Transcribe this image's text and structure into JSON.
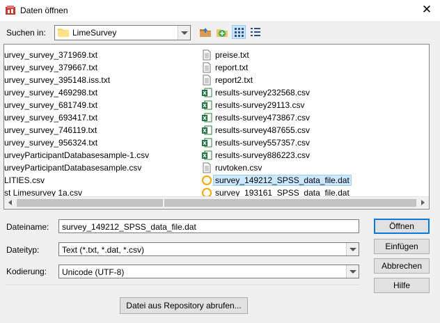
{
  "window": {
    "title": "Daten öffnen",
    "close_glyph": "✕"
  },
  "toolbar": {
    "lookin_label": "Suchen in:",
    "folder": "LimeSurvey",
    "icons": [
      "up-folder-icon",
      "new-folder-icon",
      "list-view-icon",
      "details-view-icon"
    ]
  },
  "files": {
    "left_column": [
      "urvey_survey_371969.txt",
      "urvey_survey_379667.txt",
      "urvey_survey_395148.iss.txt",
      "urvey_survey_469298.txt",
      "urvey_survey_681749.txt",
      "urvey_survey_693417.txt",
      "urvey_survey_746119.txt",
      "urvey_survey_956324.txt",
      "urveyParticipantDatabasesample-1.csv",
      "urveyParticipantDatabasesample.csv",
      "LITIES.csv",
      "st Limesurvey 1a.csv"
    ],
    "right_column": [
      {
        "name": "preise.txt",
        "icon": "text-file-icon"
      },
      {
        "name": "report.txt",
        "icon": "text-file-icon"
      },
      {
        "name": "report2.txt",
        "icon": "text-file-icon"
      },
      {
        "name": "results-survey232568.csv",
        "icon": "excel-file-icon"
      },
      {
        "name": "results-survey29113.csv",
        "icon": "excel-file-icon"
      },
      {
        "name": "results-survey473867.csv",
        "icon": "excel-file-icon"
      },
      {
        "name": "results-survey487655.csv",
        "icon": "excel-file-icon"
      },
      {
        "name": "results-survey557357.csv",
        "icon": "excel-file-icon"
      },
      {
        "name": "results-survey886223.csv",
        "icon": "excel-file-icon"
      },
      {
        "name": "ruvtoken.csv",
        "icon": "text-file-icon"
      },
      {
        "name": "survey_149212_SPSS_data_file.dat",
        "icon": "spss-data-icon",
        "selected": true
      },
      {
        "name": "survey_193161_SPSS_data_file.dat",
        "icon": "spss-data-icon"
      }
    ]
  },
  "form": {
    "filename_label": "Dateiname:",
    "filename_value": "survey_149212_SPSS_data_file.dat",
    "filetype_label": "Dateityp:",
    "filetype_value": "Text (*.txt, *.dat, *.csv)",
    "encoding_label": "Kodierung:",
    "encoding_value": "Unicode (UTF-8)"
  },
  "buttons": {
    "open": "Öffnen",
    "paste": "Einfügen",
    "cancel": "Abbrechen",
    "help": "Hilfe",
    "repository": "Datei aus Repository abrufen..."
  },
  "colors": {
    "accent": "#0078d7",
    "selection": "#cce8ff",
    "dialog_bg": "#f0f0f0"
  }
}
